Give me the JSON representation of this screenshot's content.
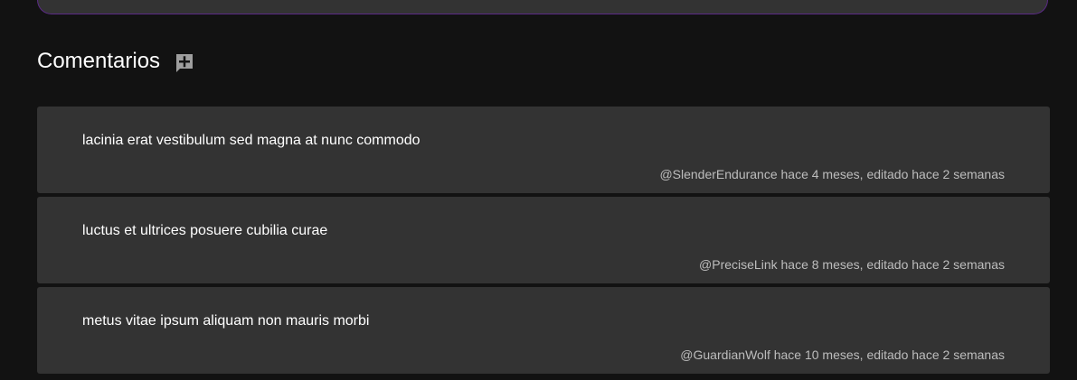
{
  "section": {
    "title": "Comentarios",
    "add_icon": "add-comment-icon"
  },
  "comments": [
    {
      "text": "lacinia erat vestibulum sed magna at nunc commodo",
      "meta": "@SlenderEndurance hace 4 meses, editado hace 2 semanas"
    },
    {
      "text": "luctus et ultrices posuere cubilia curae",
      "meta": "@PreciseLink hace 8 meses, editado hace 2 semanas"
    },
    {
      "text": "metus vitae ipsum aliquam non mauris morbi",
      "meta": "@GuardianWolf hace 10 meses, editado hace 2 semanas"
    }
  ],
  "colors": {
    "background": "#121212",
    "card": "#333333",
    "accent_border": "#5b2a86",
    "text_primary": "#ffffff",
    "text_secondary": "#bdbdbd"
  }
}
